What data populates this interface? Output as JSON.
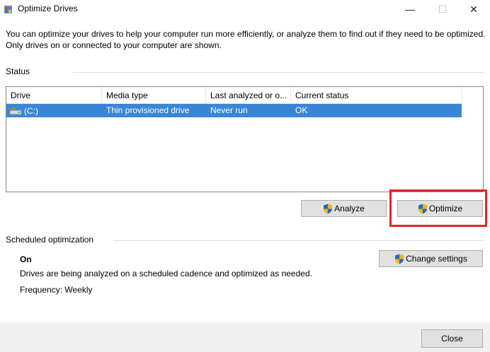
{
  "window": {
    "title": "Optimize Drives",
    "minimize_glyph": "—",
    "maximize_glyph": "☐",
    "close_glyph": "✕"
  },
  "description": "You can optimize your drives to help your computer run more efficiently, or analyze them to find out if they need to be optimized. Only drives on or connected to your computer are shown.",
  "status": {
    "label": "Status",
    "columns": [
      "Drive",
      "Media type",
      "Last analyzed or o...",
      "Current status"
    ],
    "rows": [
      {
        "drive": "(C:)",
        "media_type": "Thin provisioned drive",
        "last_analyzed": "Never run",
        "current_status": "OK",
        "selected": true
      }
    ]
  },
  "actions": {
    "analyze_label": "Analyze",
    "optimize_label": "Optimize"
  },
  "scheduled": {
    "label": "Scheduled optimization",
    "state": "On",
    "detail": "Drives are being analyzed on a scheduled cadence and optimized as needed.",
    "frequency": "Frequency: Weekly",
    "change_settings_label": "Change settings"
  },
  "footer": {
    "close_label": "Close"
  },
  "colors": {
    "selection": "#3a86d6",
    "highlight_box": "#e1262e",
    "button_face": "#e1e1e1"
  },
  "icons": [
    "defrag-app-icon",
    "drive-icon",
    "uac-shield-icon"
  ]
}
